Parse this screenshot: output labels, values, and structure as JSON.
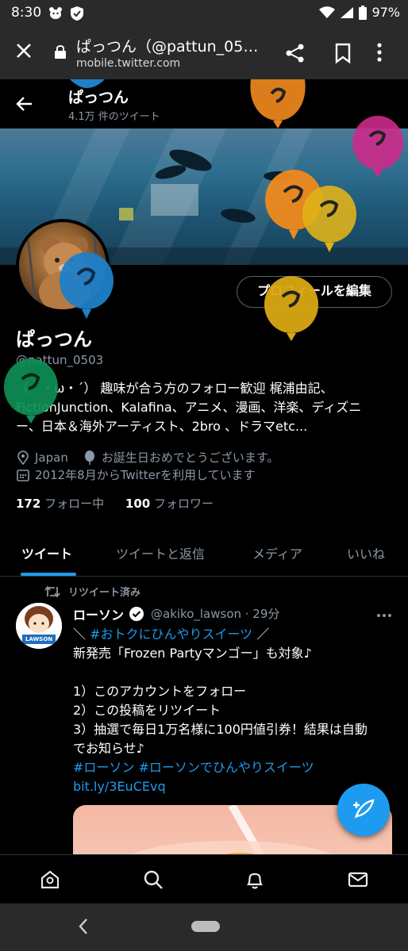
{
  "status_bar": {
    "time": "8:30",
    "battery": "97%"
  },
  "browser": {
    "title": "ぱっつん（@pattun_050…",
    "url": "mobile.twitter.com"
  },
  "header": {
    "name": "ぱっつん",
    "tweet_count": "4.1万 件のツイート"
  },
  "profile": {
    "name": "ぱっつん",
    "handle": "@pattun_0503",
    "edit_button": "プロフィールを編集",
    "bio_lines": [
      "（｀・ω・´） 趣味が合う方のフォロー歓迎 梶浦由記、",
      "FictionJunction、Kalafina、アニメ、漫画、洋楽、ディズニ",
      "ー、日本＆海外アーティスト、2bro 、ドラマetc..."
    ],
    "location": "Japan",
    "birthday": "お誕生日おめでとうございます。",
    "joined": "2012年8月からTwitterを利用しています",
    "following_count": "172",
    "following_label": "フォロー中",
    "followers_count": "100",
    "followers_label": "フォロワー"
  },
  "tabs": [
    "ツイート",
    "ツイートと返信",
    "メディア",
    "いいね"
  ],
  "tweet": {
    "retweet_label": "リツイート済み",
    "author": "ローソン",
    "handle_time": "@akiko_lawson · 29分",
    "avatar_text": "LAWSON",
    "line1_prefix": "＼ ",
    "line1_tag": "#おトクにひんやりスイーツ",
    "line1_suffix": " ／",
    "line2": "新発売「Frozen Partyマンゴー」も対象♪",
    "line3": "1）このアカウントをフォロー",
    "line4": "2）この投稿をリツイート",
    "line5": "3）抽選で毎日1万名様に100円値引券！結果は自動",
    "line6": "でお知らせ♪",
    "hashtags": "#ローソン #ローソンでひんやりスイーツ",
    "link": "bit.ly/3EuCEvq"
  }
}
